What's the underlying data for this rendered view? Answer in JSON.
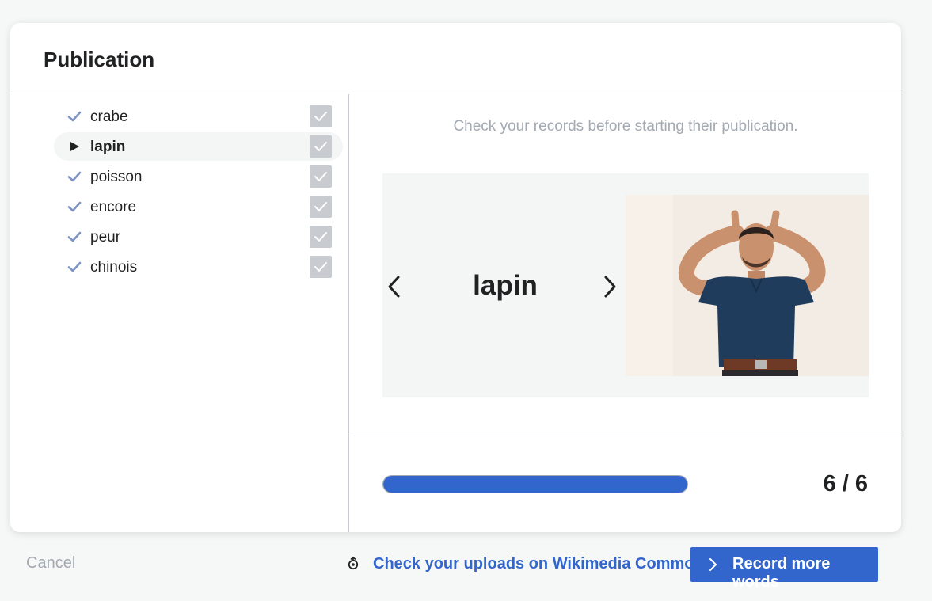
{
  "dialog": {
    "title": "Publication"
  },
  "words": [
    {
      "label": "crabe",
      "status": "check-icon",
      "active": false,
      "selected": true
    },
    {
      "label": "lapin",
      "status": "play-icon",
      "active": true,
      "selected": true
    },
    {
      "label": "poisson",
      "status": "check-icon",
      "active": false,
      "selected": true
    },
    {
      "label": "encore",
      "status": "check-icon",
      "active": false,
      "selected": true
    },
    {
      "label": "peur",
      "status": "check-icon",
      "active": false,
      "selected": true
    },
    {
      "label": "chinois",
      "status": "check-icon",
      "active": false,
      "selected": true
    }
  ],
  "preview": {
    "instructions": "Check your records before starting their publication.",
    "current_word": "lapin",
    "prev_icon": "chevron-left-icon",
    "next_icon": "chevron-right-icon"
  },
  "progress": {
    "count_text": "6 / 6",
    "fraction": 1.0
  },
  "footer": {
    "cancel_label": "Cancel",
    "commons_label": "Check your uploads on Wikimedia Commons",
    "commons_icon": "wikimedia-commons-icon",
    "record_more_label": "Record more words",
    "record_more_icon": "chevron-right-icon"
  },
  "colors": {
    "accent": "#3366cc",
    "muted": "#a2a9b1",
    "checkbox": "#c8ccd1",
    "check_mark": "#7c93c3"
  }
}
